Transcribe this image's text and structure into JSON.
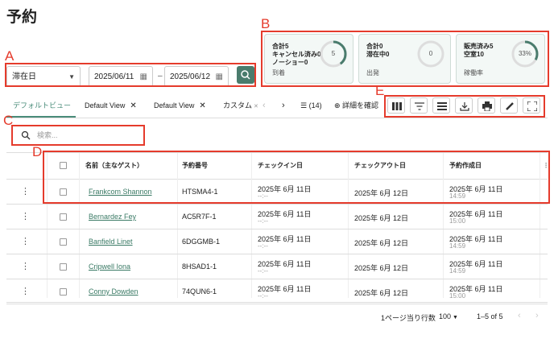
{
  "page_title": "予約",
  "filters": {
    "select_value": "滞在日",
    "date_from": "2025/06/11",
    "date_to": "2025/06/12",
    "dash": "–"
  },
  "cards": [
    {
      "lines": [
        "合計5",
        "キャンセル済み0",
        "ノーショー0"
      ],
      "ring_text": "5",
      "ring_fraction": 0.4,
      "footer": "到着"
    },
    {
      "lines": [
        "合計0",
        "滞在中0"
      ],
      "ring_text": "0",
      "ring_fraction": 0,
      "footer": "出発"
    },
    {
      "lines": [
        "販売済み5",
        "空室10"
      ],
      "ring_text": "33%",
      "ring_fraction": 0.33,
      "footer": "稼働率"
    }
  ],
  "tabs": [
    "デフォルトビュー",
    "Default View",
    "Default View",
    "カスタム"
  ],
  "tab_active": "デフォルトビュー",
  "count_text": "(14)",
  "details_label": "詳細を確認",
  "search_placeholder": "検索...",
  "columns": [
    "名前（主なゲスト）",
    "予約番号",
    "チェックイン日",
    "チェックアウト日",
    "予約作成日"
  ],
  "rows": [
    {
      "name": "Frankcom Shannon",
      "number": "HTSMA4-1",
      "checkin": "2025年 6月 11日",
      "checkin_sub": "--:--",
      "checkout": "2025年 6月 12日",
      "created": "2025年 6月 11日",
      "created_time": "14:59"
    },
    {
      "name": "Bernardez Fey",
      "number": "AC5R7F-1",
      "checkin": "2025年 6月 11日",
      "checkin_sub": "--:--",
      "checkout": "2025年 6月 12日",
      "created": "2025年 6月 11日",
      "created_time": "15:00"
    },
    {
      "name": "Banfield Linet",
      "number": "6DGGMB-1",
      "checkin": "2025年 6月 11日",
      "checkin_sub": "--:--",
      "checkout": "2025年 6月 12日",
      "created": "2025年 6月 11日",
      "created_time": "14:59"
    },
    {
      "name": "Cripwell Iona",
      "number": "8HSAD1-1",
      "checkin": "2025年 6月 11日",
      "checkin_sub": "--:--",
      "checkout": "2025年 6月 12日",
      "created": "2025年 6月 11日",
      "created_time": "14:59"
    },
    {
      "name": "Conny Dowden",
      "number": "74QUN6-1",
      "checkin": "2025年 6月 11日",
      "checkin_sub": "--:--",
      "checkout": "2025年 6月 12日",
      "created": "2025年 6月 11日",
      "created_time": "15:00"
    }
  ],
  "pagination": {
    "rows_per_page_label": "1ページ当り行数",
    "rows_per_page": "100",
    "range": "1–5 of 5"
  },
  "annotation_labels": [
    "A",
    "B",
    "C",
    "D",
    "E"
  ],
  "colors": {
    "accent": "#4a7c6d",
    "annotation": "#e53b2c"
  }
}
